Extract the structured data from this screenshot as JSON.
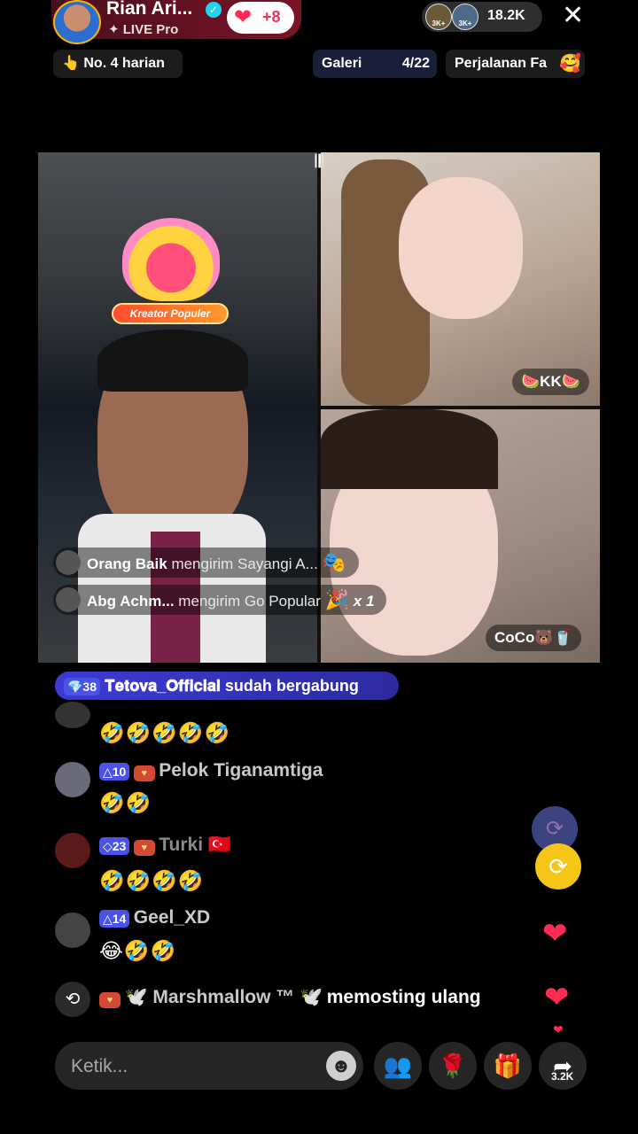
{
  "header": {
    "host_name": "Rian Ari...",
    "host_subtitle": "✦ LIVE Pro",
    "likes_label": "+8",
    "viewer_avatar_badges": [
      "3K+",
      "3K+"
    ],
    "viewer_count": "18.2K",
    "close_glyph": "✕"
  },
  "chips": {
    "rank": "👆 No. 4 harian",
    "gallery_label": "Galeri",
    "gallery_count": "4/22",
    "journey": "Perjalanan Fa"
  },
  "video": {
    "host_badge": "Kreator Populer",
    "guest1_name": "🍉KK🍉",
    "guest2_name": "CoCo🐻🥤"
  },
  "gifts": [
    {
      "user": "Orang Baik",
      "action": "mengirim Sayangi A...",
      "icon": "🎭"
    },
    {
      "user": "Abg Achm...",
      "action": "mengirim Go Popular",
      "icon": "🎉",
      "count": "x 1"
    }
  ],
  "join": {
    "level": "💎38",
    "user": "𝐓𝐞𝐭𝐨𝐯𝐚_𝐎𝐟𝐟𝐢𝐜𝐢𝐚𝐥",
    "text": "sudah bergabung"
  },
  "chat": [
    {
      "emojis": "🤣🤣🤣🤣🤣"
    },
    {
      "level": "△10",
      "name": "Pelok Tiganamtiga",
      "emojis": "🤣🤣"
    },
    {
      "level": "◇23",
      "name": "Turki 🇹🇷",
      "emojis": "🤣🤣🤣🤣"
    },
    {
      "level": "△14",
      "name": "Geel_XD",
      "emojis": "😂🤣🤣"
    }
  ],
  "repost": {
    "user": "🕊️ Marshmallow ™ 🕊️",
    "text": "memosting ulang"
  },
  "bottom": {
    "input_placeholder": "Ketik...",
    "share_count": "3.2K"
  },
  "colors": {
    "accent": "#fe2c55",
    "join_pill": "#3d3ad6",
    "repost_yellow": "#f5c518"
  }
}
